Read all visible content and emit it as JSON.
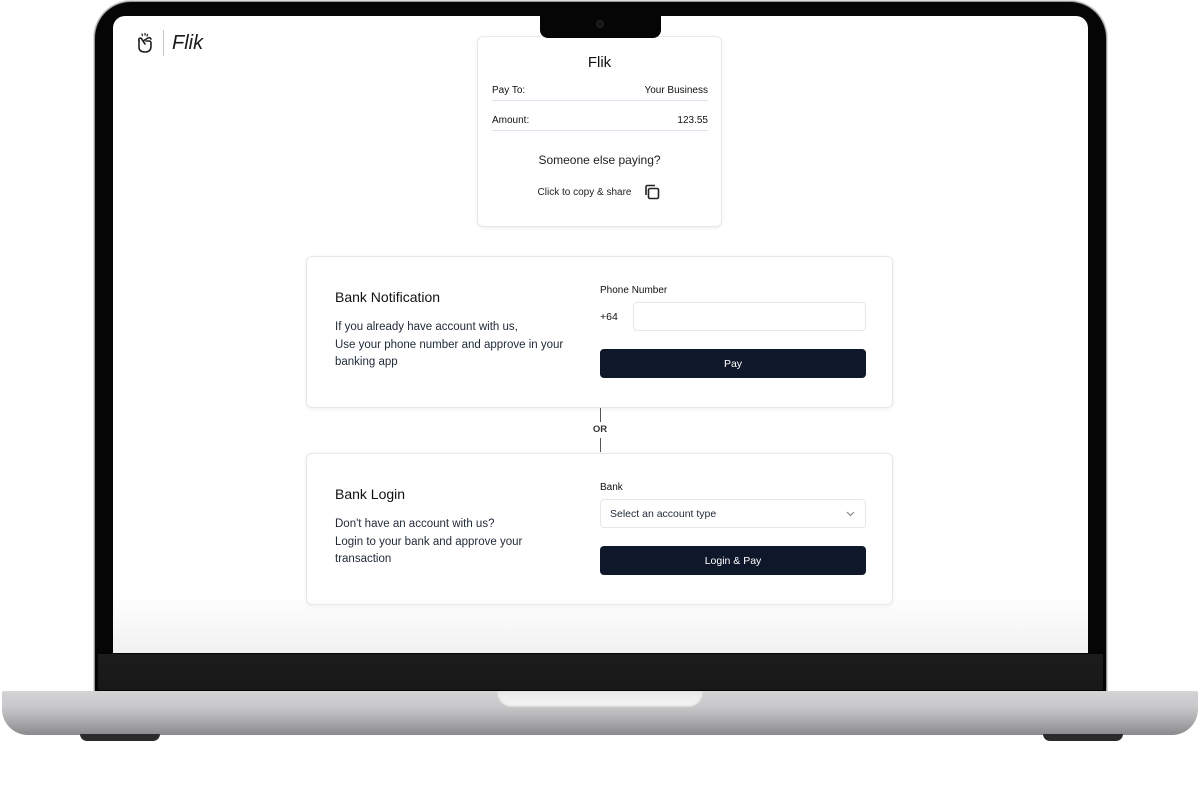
{
  "app": {
    "logo_text": "Flik",
    "logo_icon": "hand-snap-icon"
  },
  "summary": {
    "title": "Flik",
    "pay_to_label": "Pay To:",
    "pay_to_value": "Your Business",
    "amount_label": "Amount:",
    "amount_value": "123.55",
    "someone_else": "Someone else paying?",
    "copy_label": "Click to copy & share",
    "copy_icon": "copy-icon"
  },
  "bank_notification": {
    "title": "Bank Notification",
    "desc_line1": "If you already have account with us,",
    "desc_line2": "Use your phone number and approve in your banking app",
    "field_label": "Phone Number",
    "prefix": "+64",
    "phone_value": "",
    "phone_placeholder": "",
    "button_label": "Pay"
  },
  "divider": {
    "label": "OR"
  },
  "bank_login": {
    "title": "Bank Login",
    "desc_line1": "Don't have an account with us?",
    "desc_line2": "Login to your bank and approve your transaction",
    "field_label": "Bank",
    "select_value": "Select an account type",
    "button_label": "Login & Pay"
  },
  "colors": {
    "button_bg": "#0f172a",
    "button_text": "#ffffff",
    "border": "#e6e8ec"
  }
}
